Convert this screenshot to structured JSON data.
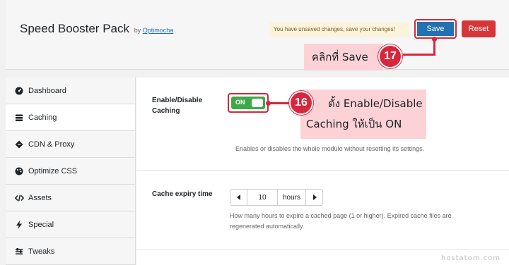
{
  "header": {
    "title": "Speed Booster Pack",
    "by": "by",
    "author": "Optimocha",
    "notice": "You have unsaved changes, save your changes!",
    "save_label": "Save",
    "reset_label": "Reset"
  },
  "sidebar": {
    "items": [
      {
        "label": "Dashboard",
        "icon": "gauge-icon"
      },
      {
        "label": "Caching",
        "icon": "server-icon"
      },
      {
        "label": "CDN & Proxy",
        "icon": "diamond-icon"
      },
      {
        "label": "Optimize CSS",
        "icon": "palette-icon"
      },
      {
        "label": "Assets",
        "icon": "code-icon"
      },
      {
        "label": "Special",
        "icon": "bolt-icon"
      },
      {
        "label": "Tweaks",
        "icon": "sliders-icon"
      }
    ],
    "active": "Caching"
  },
  "caching": {
    "enable_label": "Enable/Disable Caching",
    "toggle_text": "ON",
    "toggle_state": "on",
    "enable_desc": "Enables or disables the whole module without resetting its settings.",
    "expiry_label": "Cache expiry time",
    "expiry_value": "10",
    "expiry_unit": "hours",
    "expiry_desc": "How many hours to expire a cached page (1 or higher). Expired cache files are regenerated automatically."
  },
  "annotations": {
    "step17_number": "17",
    "step17_text": "คลิกที่ Save",
    "step16_number": "16",
    "step16_line1": "ตั้ง Enable/Disable",
    "step16_line2": "Caching ให้เป็น ON",
    "accent_color": "#d7263d",
    "callout_color": "#fcd2d6"
  },
  "watermark": "hostatom.com"
}
